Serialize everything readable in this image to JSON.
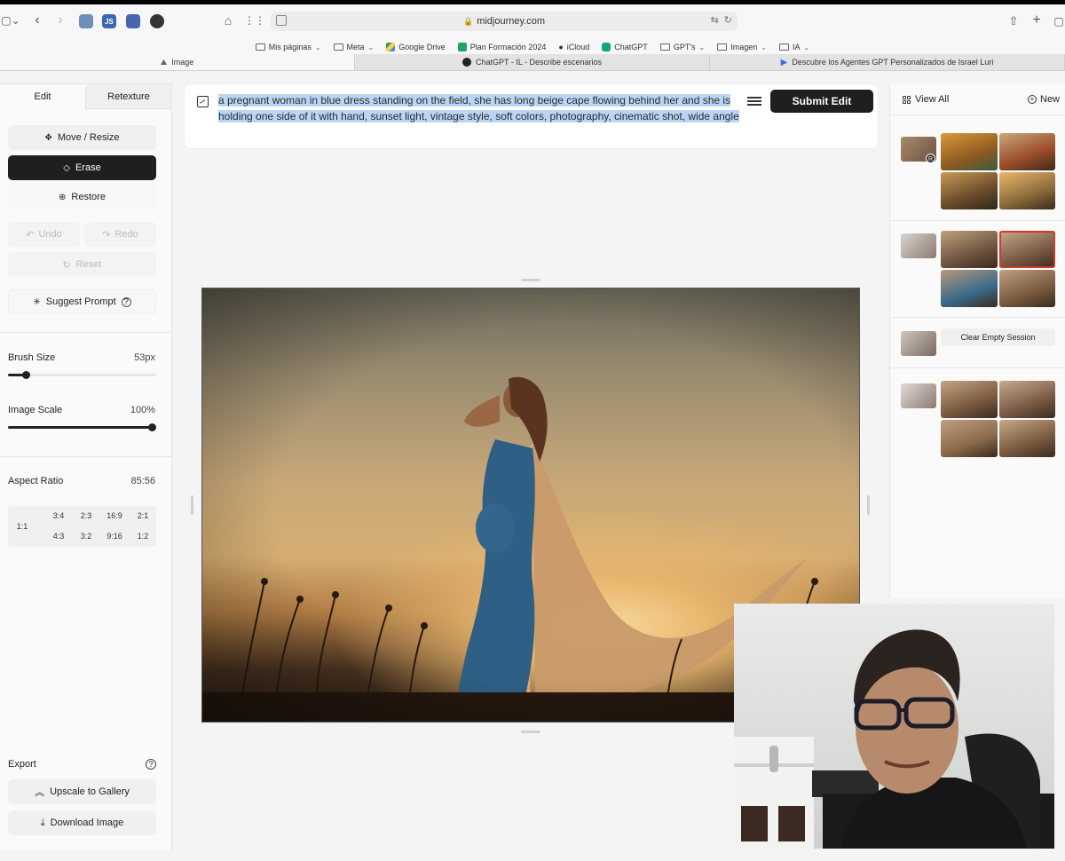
{
  "browser": {
    "url": "midjourney.com",
    "bookmarks": [
      "Mis páginas",
      "Meta",
      "Google Drive",
      "Plan Formación 2024",
      "iCloud",
      "ChatGPT",
      "GPT's",
      "Imagen",
      "IA"
    ],
    "tabs": [
      "Image",
      "ChatGPT - IL - Describe escenarios",
      "Descubre los Agentes GPT Personalizados de Israel Luri"
    ]
  },
  "panel": {
    "tab_edit": "Edit",
    "tab_retexture": "Retexture",
    "move_resize": "Move / Resize",
    "erase": "Erase",
    "restore": "Restore",
    "undo": "Undo",
    "redo": "Redo",
    "reset": "Reset",
    "suggest_prompt": "Suggest Prompt",
    "brush_size_label": "Brush Size",
    "brush_size_value": "53px",
    "brush_size_fraction": 0.1,
    "image_scale_label": "Image Scale",
    "image_scale_value": "100%",
    "image_scale_fraction": 1.0,
    "aspect_ratio_label": "Aspect Ratio",
    "aspect_ratio_value": "85:56",
    "aspect_options": [
      "1:1",
      "3:4",
      "2:3",
      "16:9",
      "2:1",
      "4:3",
      "3:2",
      "9:16",
      "1:2"
    ],
    "export_label": "Export",
    "upscale": "Upscale to Gallery",
    "download": "Download Image"
  },
  "prompt": {
    "text": "a pregnant woman in blue dress standing on the field, she has long beige cape flowing behind her and she is holding one side of it with hand, sunset light, vintage style, soft colors, photography, cinematic shot, wide angle",
    "submit": "Submit Edit"
  },
  "sidebar": {
    "view_all": "View All",
    "new": "New",
    "badge": "R",
    "clear_empty_session": "Clear Empty Session"
  }
}
